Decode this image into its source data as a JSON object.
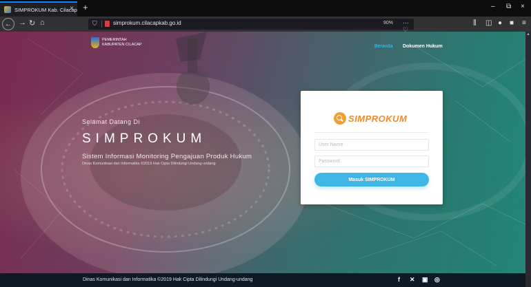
{
  "browser": {
    "tab_title": "SIMPROKUM Kab. Cilacap",
    "tab_close": "×",
    "new_tab": "+",
    "url": "simprokum.cilacapkab.go.id",
    "zoom": "90%",
    "url_icons": "··· ♡ ☆",
    "win_min": "–",
    "win_max": "⧉",
    "win_close": "×"
  },
  "header": {
    "logo_line1": "PEMERINTAH",
    "logo_line2": "KABUPATEN CILACAP",
    "nav": [
      "Beranda",
      "Dokumen Hukum"
    ]
  },
  "hero": {
    "welcome": "Selamat Datang Di",
    "title": "SIMPROKUM",
    "subtitle": "Sistem Informasi Monitoring Pengajuan Produk Hukum",
    "note": "Dinas Komunikasi dan Informatika ©2019 Hak Cipta Dilindungi Undang-undang"
  },
  "login": {
    "brand": "SIMPROKUM",
    "username_placeholder": "User Name",
    "password_placeholder": "Password",
    "submit_label": "Masuk SIMPROKUM"
  },
  "footer": {
    "text": "Dinas Komunikasi dan Informatika ©2019 Hak Cipta Dilindungi Undang-undang"
  },
  "colors": {
    "accent": "#3fb6e4",
    "brand": "#f08a2a",
    "nav_active": "#4ec8f0"
  }
}
